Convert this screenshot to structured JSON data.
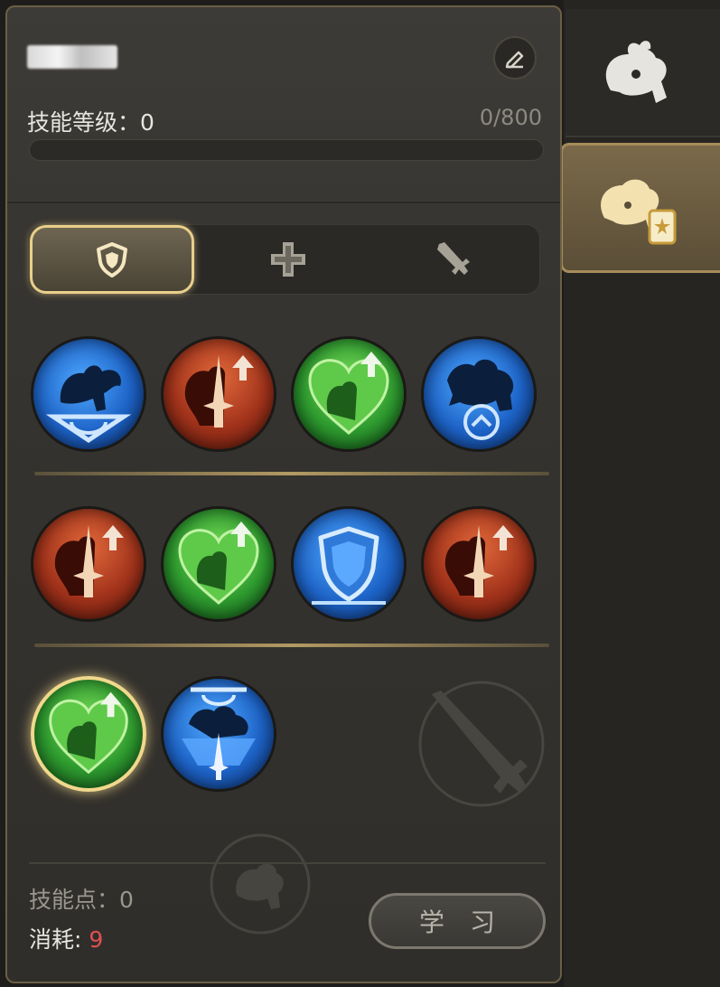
{
  "player": {
    "name": "■■■■■"
  },
  "header": {
    "skill_level_label": "技能等级：",
    "skill_level_value": "0",
    "xp_text": "0/800",
    "xp_progress": 0
  },
  "tabs": [
    {
      "icon": "shield-icon",
      "active": true
    },
    {
      "icon": "cross-icon",
      "active": false
    },
    {
      "icon": "sword-icon",
      "active": false
    }
  ],
  "skills": [
    [
      {
        "icon": "blue-pegasus-skill-icon",
        "color": "blue"
      },
      {
        "icon": "red-sword-up-skill-icon",
        "color": "red"
      },
      {
        "icon": "green-heart-up-skill-icon",
        "color": "green"
      },
      {
        "icon": "blue-chocobo-up-skill-icon",
        "color": "blue"
      }
    ],
    [
      {
        "icon": "red-sword-up-skill-icon",
        "color": "red"
      },
      {
        "icon": "green-heart-up-skill-icon",
        "color": "green"
      },
      {
        "icon": "blue-shield-skill-icon",
        "color": "blue"
      },
      {
        "icon": "red-sword-up-skill-icon",
        "color": "red"
      }
    ],
    [
      {
        "icon": "green-heart-up-skill-icon",
        "color": "green",
        "selected": true
      },
      {
        "icon": "blue-sword-shield-skill-icon",
        "color": "blue"
      }
    ]
  ],
  "footer": {
    "points_label": "技能点：",
    "points_value": "0",
    "cost_label": "消耗: ",
    "cost_value": "9",
    "learn_button": "学习"
  },
  "side_tabs": [
    {
      "icon": "chocobo-head-icon",
      "active": false
    },
    {
      "icon": "chocobo-card-icon",
      "active": true
    }
  ],
  "colors": {
    "accent_gold": "#e8cf8a",
    "cost_red": "#e05050"
  }
}
